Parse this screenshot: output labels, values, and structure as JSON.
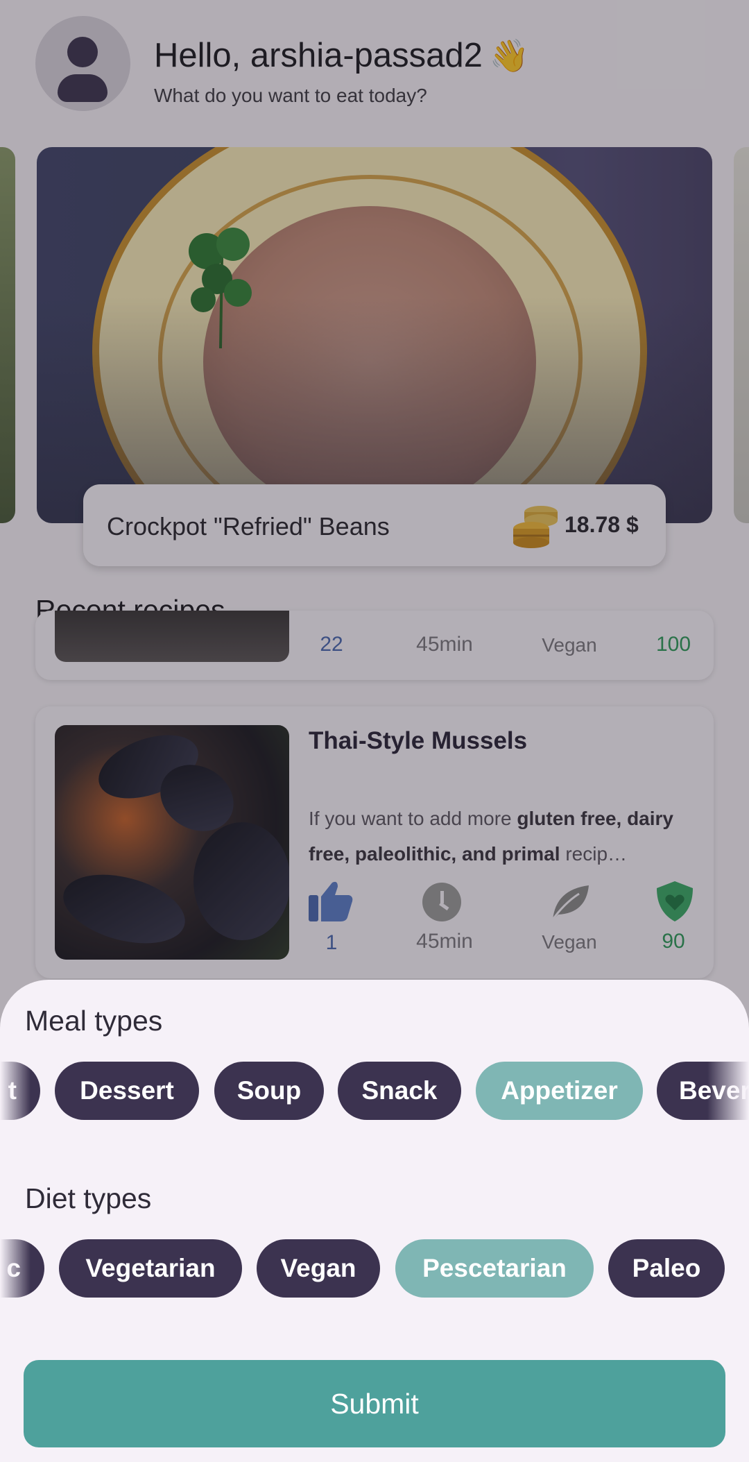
{
  "header": {
    "greeting": "Hello, arshia-passad2",
    "wave_emoji": "👋",
    "subtitle": "What do you want to eat today?"
  },
  "featured": {
    "name": "Crockpot \"Refried\" Beans",
    "price": "18.78 $"
  },
  "recent": {
    "title": "Recent recipes",
    "cards": [
      {
        "likes": "22",
        "time": "45min",
        "diet": "Vegan",
        "score": "100"
      },
      {
        "title": "Thai-Style Mussels",
        "desc_prefix": "If you want to add more ",
        "desc_bold1": "gluten free, dairy free, paleolithic, and primal",
        "desc_suffix": " recip…",
        "likes": "1",
        "time": "45min",
        "diet": "Vegan",
        "score": "90"
      }
    ]
  },
  "sheet": {
    "meal_label": "Meal types",
    "meal_chips": [
      {
        "label": "t",
        "selected": false
      },
      {
        "label": "Dessert",
        "selected": false
      },
      {
        "label": "Soup",
        "selected": false
      },
      {
        "label": "Snack",
        "selected": false
      },
      {
        "label": "Appetizer",
        "selected": true
      },
      {
        "label": "Bever",
        "selected": false
      }
    ],
    "diet_label": "Diet types",
    "diet_chips": [
      {
        "label": "c",
        "selected": false
      },
      {
        "label": "Vegetarian",
        "selected": false
      },
      {
        "label": "Vegan",
        "selected": false
      },
      {
        "label": "Pescetarian",
        "selected": true
      },
      {
        "label": "Paleo",
        "selected": false
      }
    ],
    "submit": "Submit"
  },
  "colors": {
    "chip_dark": "#3c3350",
    "chip_selected": "#7fb6b4",
    "submit_bg": "#4ea19c",
    "like_blue": "#4a68b0",
    "score_green": "#2e9a5a"
  }
}
